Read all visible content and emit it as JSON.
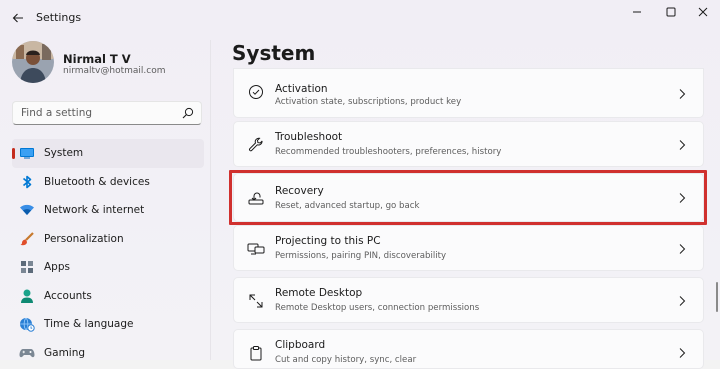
{
  "window": {
    "app_title": "Settings",
    "controls": [
      "minimize-icon",
      "maximize-icon",
      "close-icon"
    ]
  },
  "profile": {
    "name": "Nirmal T V",
    "email": "nirmaltv@hotmail.com"
  },
  "search": {
    "placeholder": "Find a setting"
  },
  "sidebar": {
    "items": [
      {
        "label": "System",
        "icon": "system-icon",
        "active": true
      },
      {
        "label": "Bluetooth & devices",
        "icon": "bluetooth-icon"
      },
      {
        "label": "Network & internet",
        "icon": "wifi-icon"
      },
      {
        "label": "Personalization",
        "icon": "brush-icon"
      },
      {
        "label": "Apps",
        "icon": "apps-icon"
      },
      {
        "label": "Accounts",
        "icon": "accounts-icon"
      },
      {
        "label": "Time & language",
        "icon": "globe-clock-icon"
      },
      {
        "label": "Gaming",
        "icon": "gaming-icon"
      }
    ]
  },
  "main": {
    "title": "System",
    "cards": [
      {
        "title": "Activation",
        "subtitle": "Activation state, subscriptions, product key",
        "icon": "activation-check-icon"
      },
      {
        "title": "Troubleshoot",
        "subtitle": "Recommended troubleshooters, preferences, history",
        "icon": "wrench-icon"
      },
      {
        "title": "Recovery",
        "subtitle": "Reset, advanced startup, go back",
        "icon": "recovery-icon",
        "highlighted": true
      },
      {
        "title": "Projecting to this PC",
        "subtitle": "Permissions, pairing PIN, discoverability",
        "icon": "projecting-icon"
      },
      {
        "title": "Remote Desktop",
        "subtitle": "Remote Desktop users, connection permissions",
        "icon": "remote-desktop-icon"
      },
      {
        "title": "Clipboard",
        "subtitle": "Cut and copy history, sync, clear",
        "icon": "clipboard-icon"
      }
    ]
  },
  "colors": {
    "accent": "#0067c0",
    "active_indicator": "#c42b1c",
    "highlight_border": "#d0302e"
  }
}
